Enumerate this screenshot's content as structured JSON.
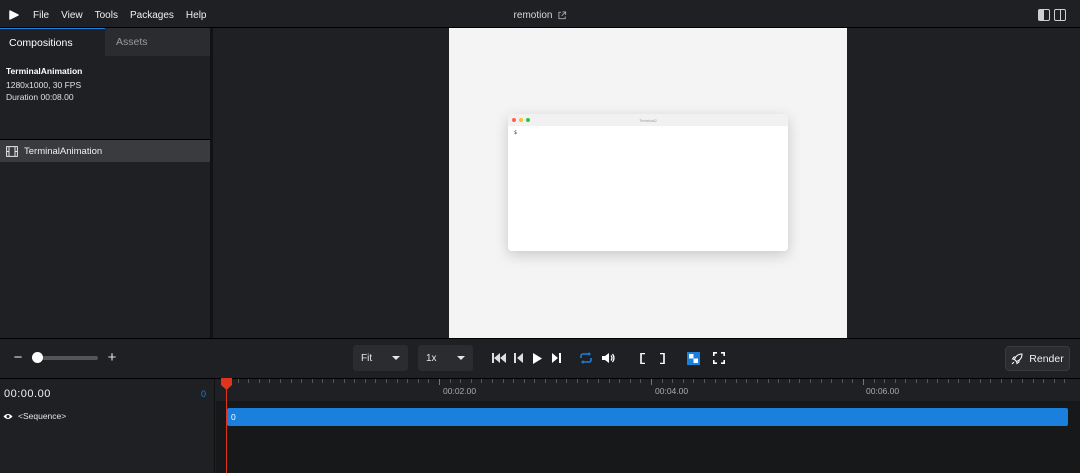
{
  "menubar": {
    "items": [
      "File",
      "View",
      "Tools",
      "Packages",
      "Help"
    ],
    "title": "remotion"
  },
  "sidebar": {
    "tabs": [
      "Compositions",
      "Assets"
    ],
    "composition": {
      "name": "TerminalAnimation",
      "resolution_fps": "1280x1000, 30 FPS",
      "duration": "Duration 00:08.00"
    },
    "items": [
      {
        "label": "TerminalAnimation"
      }
    ]
  },
  "preview": {
    "terminal_title": "Terminal2",
    "prompt": "$"
  },
  "controls": {
    "size_select": "Fit",
    "speed_select": "1x",
    "render_label": "Render"
  },
  "timeline": {
    "timecode": "00:00.00",
    "frame": "0",
    "track_name": "<Sequence>",
    "track_bar_label": "0",
    "ruler_labels": [
      "00:02.00",
      "00:04.00",
      "00:06.00"
    ]
  },
  "colors": {
    "accent": "#1b7fde",
    "playhead": "#e0341e",
    "mac_red": "#ff5f57",
    "mac_yellow": "#febc2e",
    "mac_green": "#28c840"
  }
}
